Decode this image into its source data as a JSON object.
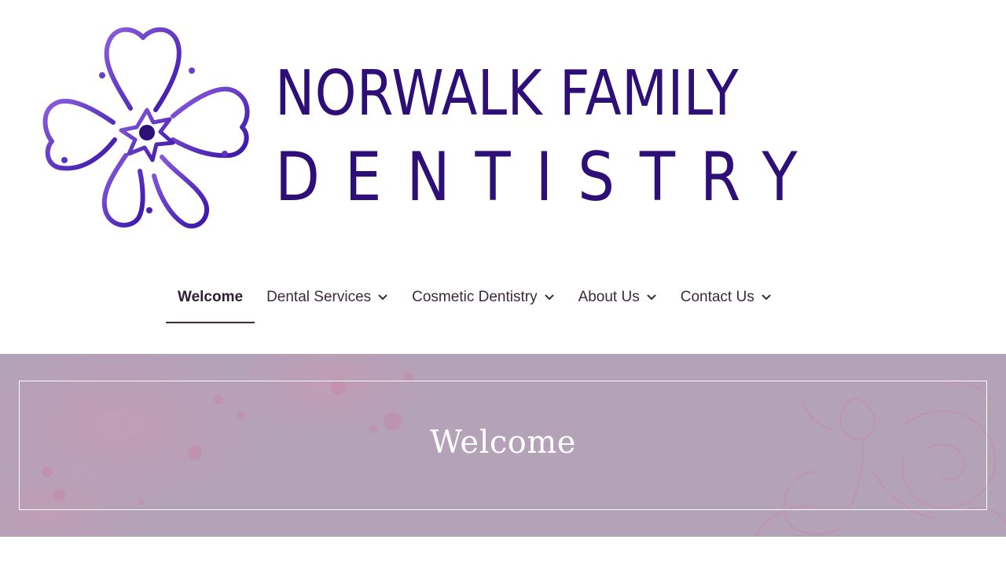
{
  "logo": {
    "line1": "NORWALK FAMILY",
    "line2": "DENTISTRY",
    "icon": "flower-tooth-logo",
    "color_primary": "#2e0f78",
    "color_accent": "#7a52d6"
  },
  "nav": {
    "items": [
      {
        "label": "Welcome",
        "active": true,
        "has_dropdown": false
      },
      {
        "label": "Dental Services",
        "active": false,
        "has_dropdown": true
      },
      {
        "label": "Cosmetic Dentistry",
        "active": false,
        "has_dropdown": true
      },
      {
        "label": "About Us",
        "active": false,
        "has_dropdown": true
      },
      {
        "label": "Contact Us",
        "active": false,
        "has_dropdown": true
      }
    ],
    "dropdown_icon": "chevron-down-icon",
    "text_color": "#3a2a3c"
  },
  "hero": {
    "title": "Welcome",
    "background_color": "#b3a2b8",
    "frame_color": "#ffffff"
  }
}
